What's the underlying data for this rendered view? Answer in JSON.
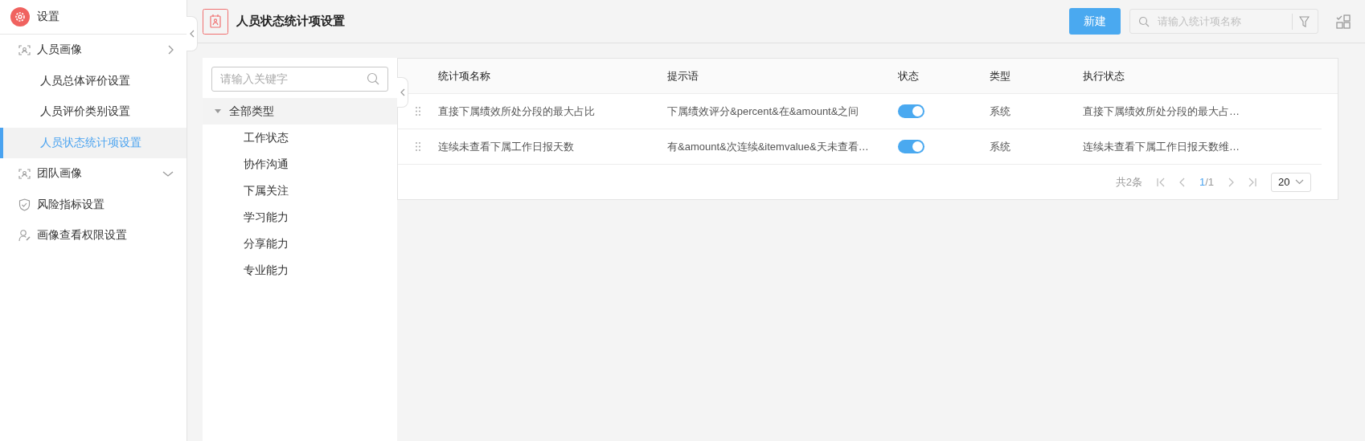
{
  "sidebar": {
    "title": "设置",
    "groups": [
      {
        "label": "人员画像",
        "expanded": true,
        "children": [
          {
            "label": "人员总体评价设置",
            "selected": false
          },
          {
            "label": "人员评价类别设置",
            "selected": false
          },
          {
            "label": "人员状态统计项设置",
            "selected": true
          }
        ]
      },
      {
        "label": "团队画像",
        "expanded": false
      },
      {
        "label": "风险指标设置",
        "kind": "shield"
      },
      {
        "label": "画像查看权限设置",
        "kind": "user"
      }
    ]
  },
  "header": {
    "title": "人员状态统计项设置",
    "new_button": "新建",
    "search": {
      "placeholder": "请输入统计项名称"
    }
  },
  "tree": {
    "search": {
      "placeholder": "请输入关键字"
    },
    "root": {
      "label": "全部类型",
      "expanded": true,
      "selected": true,
      "children": [
        {
          "label": "工作状态",
          "selected": false
        },
        {
          "label": "协作沟通",
          "selected": false
        },
        {
          "label": "下属关注",
          "selected": false
        },
        {
          "label": "学习能力",
          "selected": false
        },
        {
          "label": "分享能力",
          "selected": false
        },
        {
          "label": "专业能力",
          "selected": false
        }
      ]
    }
  },
  "table": {
    "columns": [
      "统计项名称",
      "提示语",
      "状态",
      "类型",
      "执行状态"
    ],
    "rows": [
      {
        "name": "直接下属绩效所处分段的最大占比",
        "hint": "下属绩效评分&percent&在&amount&之间",
        "on": true,
        "type": "系统",
        "exec": "直接下属绩效所处分段的最大占…"
      },
      {
        "name": "连续未查看下属工作日报天数",
        "hint": "有&amount&次连续&itemvalue&天未查看…",
        "on": true,
        "type": "系统",
        "exec": "连续未查看下属工作日报天数维…"
      }
    ],
    "pagination": {
      "total": "共2条",
      "current": "1",
      "rest": "/1",
      "page_size": "20"
    }
  }
}
